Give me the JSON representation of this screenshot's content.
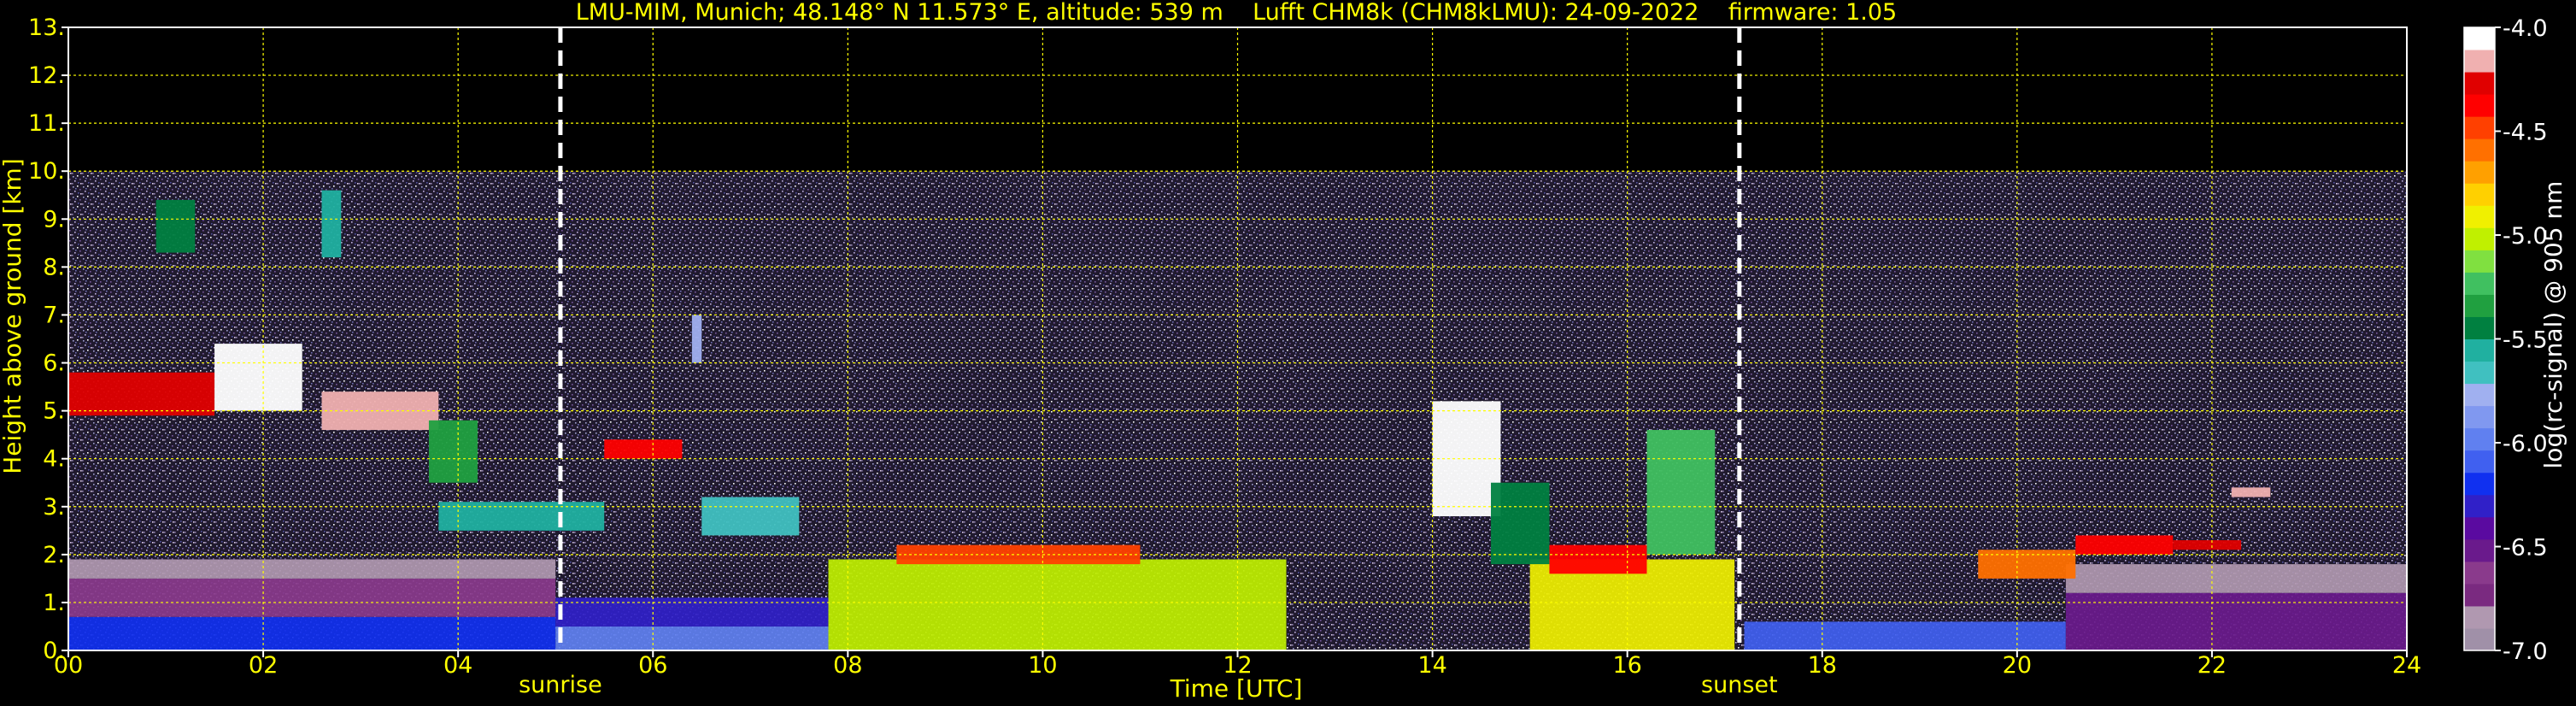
{
  "chart_data": {
    "type": "heatmap",
    "title": "LMU-MIM, Munich; 48.148° N 11.573° E, altitude: 539 m    Lufft CHM8k (CHM8kLMU): 24-09-2022    firmware: 1.05",
    "xlabel": "Time [UTC]",
    "ylabel": "Height above ground [km]",
    "xlim": [
      0,
      24
    ],
    "ylim": [
      0,
      13
    ],
    "xticks": [
      "00",
      "02",
      "04",
      "06",
      "08",
      "10",
      "12",
      "14",
      "16",
      "18",
      "20",
      "22",
      "24"
    ],
    "xtick_values": [
      0,
      2,
      4,
      6,
      8,
      10,
      12,
      14,
      16,
      18,
      20,
      22,
      24
    ],
    "yticks": [
      "0.",
      "1.",
      "2.",
      "3.",
      "4.",
      "5.",
      "6.",
      "7.",
      "8.",
      "9.",
      "10.",
      "11.",
      "12.",
      "13."
    ],
    "ytick_values": [
      0,
      1,
      2,
      3,
      4,
      5,
      6,
      7,
      8,
      9,
      10,
      11,
      12,
      13
    ],
    "grid": true,
    "data_top_km": 10,
    "markers": [
      {
        "label": "sunrise",
        "time": 5.05
      },
      {
        "label": "sunset",
        "time": 17.15
      }
    ],
    "colorbar": {
      "label": "log(rc-signal) @ 905 nm",
      "range": [
        -7.0,
        -4.0
      ],
      "ticks": [
        "-4.0",
        "-4.5",
        "-5.0",
        "-5.5",
        "-6.0",
        "-6.5",
        "-7.0"
      ],
      "tick_values": [
        -4.0,
        -4.5,
        -5.0,
        -5.5,
        -6.0,
        -6.5,
        -7.0
      ],
      "colors": [
        "#a090a8",
        "#b098b0",
        "#7a2a80",
        "#8a3a8c",
        "#6a1a8c",
        "#5a0aa0",
        "#3020c8",
        "#1030f0",
        "#4060f0",
        "#6080f0",
        "#8098f0",
        "#a0b0f0",
        "#40c0c0",
        "#20b0a0",
        "#008040",
        "#20a040",
        "#40c060",
        "#80e040",
        "#c0f000",
        "#f0f000",
        "#ffd000",
        "#ffa000",
        "#ff7000",
        "#ff4000",
        "#ff0000",
        "#e00000",
        "#f0b0b0",
        "#ffffff"
      ]
    },
    "layers": [
      {
        "t0": 0.0,
        "t1": 5.0,
        "h0": 0.0,
        "h1": 0.7,
        "value": -6.2
      },
      {
        "t0": 0.0,
        "t1": 5.0,
        "h0": 0.7,
        "h1": 1.5,
        "value": -6.6
      },
      {
        "t0": 0.0,
        "t1": 5.0,
        "h0": 1.5,
        "h1": 1.9,
        "value": -6.8
      },
      {
        "t0": 5.0,
        "t1": 7.8,
        "h0": 0.0,
        "h1": 0.5,
        "value": -6.0
      },
      {
        "t0": 5.0,
        "t1": 7.8,
        "h0": 0.5,
        "h1": 1.1,
        "value": -6.3
      },
      {
        "t0": 7.8,
        "t1": 12.5,
        "h0": 0.0,
        "h1": 1.9,
        "value": -5.0
      },
      {
        "t0": 15.0,
        "t1": 17.1,
        "h0": 0.0,
        "h1": 1.9,
        "value": -4.9
      },
      {
        "t0": 17.2,
        "t1": 20.5,
        "h0": 0.0,
        "h1": 0.6,
        "value": -6.1
      },
      {
        "t0": 20.5,
        "t1": 24.0,
        "h0": 0.0,
        "h1": 1.2,
        "value": -6.5
      },
      {
        "t0": 20.5,
        "t1": 24.0,
        "h0": 1.2,
        "h1": 1.8,
        "value": -6.8
      }
    ],
    "cloud_layers": [
      {
        "t0": 0.0,
        "t1": 1.5,
        "h0": 4.9,
        "h1": 5.8,
        "value": -4.3
      },
      {
        "t0": 1.5,
        "t1": 2.4,
        "h0": 5.0,
        "h1": 6.4,
        "value": -4.1
      },
      {
        "t0": 2.6,
        "t1": 3.8,
        "h0": 4.6,
        "h1": 5.4,
        "value": -4.2
      },
      {
        "t0": 3.7,
        "t1": 4.2,
        "h0": 3.5,
        "h1": 4.8,
        "value": -5.3
      },
      {
        "t0": 3.8,
        "t1": 5.5,
        "h0": 2.5,
        "h1": 3.1,
        "value": -5.6
      },
      {
        "t0": 5.5,
        "t1": 6.3,
        "h0": 4.0,
        "h1": 4.4,
        "value": -4.4
      },
      {
        "t0": 6.5,
        "t1": 7.5,
        "h0": 2.4,
        "h1": 3.2,
        "value": -5.7
      },
      {
        "t0": 8.5,
        "t1": 11.0,
        "h0": 1.8,
        "h1": 2.2,
        "value": -4.5
      },
      {
        "t0": 14.0,
        "t1": 14.7,
        "h0": 2.8,
        "h1": 5.2,
        "value": -4.1
      },
      {
        "t0": 14.6,
        "t1": 15.2,
        "h0": 1.8,
        "h1": 3.5,
        "value": -5.5
      },
      {
        "t0": 15.2,
        "t1": 16.2,
        "h0": 1.6,
        "h1": 2.2,
        "value": -4.4
      },
      {
        "t0": 16.2,
        "t1": 16.9,
        "h0": 2.0,
        "h1": 4.6,
        "value": -5.2
      },
      {
        "t0": 19.6,
        "t1": 20.6,
        "h0": 1.5,
        "h1": 2.1,
        "value": -4.6
      },
      {
        "t0": 20.6,
        "t1": 21.6,
        "h0": 2.0,
        "h1": 2.4,
        "value": -4.4
      },
      {
        "t0": 21.6,
        "t1": 22.3,
        "h0": 2.1,
        "h1": 2.3,
        "value": -4.3
      },
      {
        "t0": 22.2,
        "t1": 22.6,
        "h0": 3.2,
        "h1": 3.4,
        "value": -4.2
      },
      {
        "t0": 0.9,
        "t1": 1.3,
        "h0": 8.3,
        "h1": 9.4,
        "value": -5.4
      },
      {
        "t0": 2.6,
        "t1": 2.8,
        "h0": 8.2,
        "h1": 9.6,
        "value": -5.6
      },
      {
        "t0": 6.4,
        "t1": 6.5,
        "h0": 6.0,
        "h1": 7.0,
        "value": -5.8
      }
    ]
  }
}
